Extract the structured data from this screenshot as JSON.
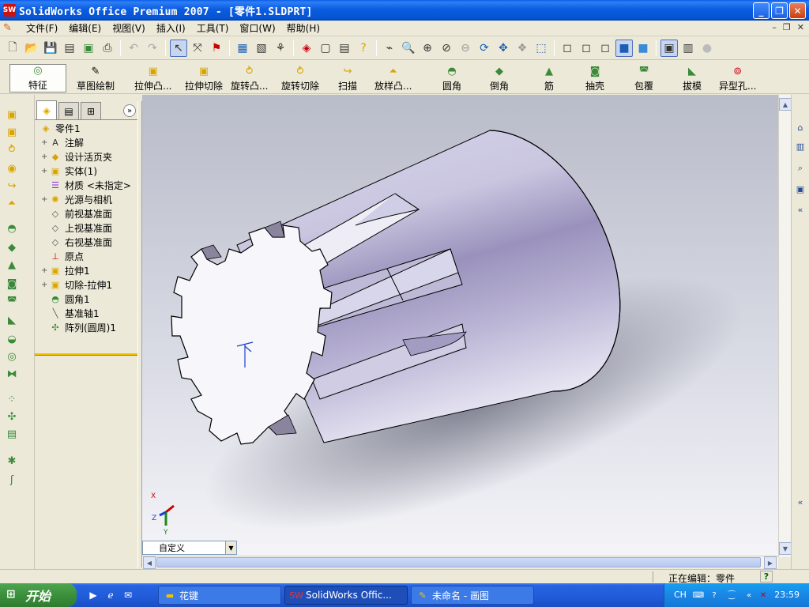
{
  "window": {
    "title": "SolidWorks Office Premium 2007 - [零件1.SLDPRT]",
    "app_icon": "SW"
  },
  "menu": {
    "items": [
      "文件(F)",
      "编辑(E)",
      "视图(V)",
      "插入(I)",
      "工具(T)",
      "窗口(W)",
      "帮助(H)"
    ]
  },
  "command_manager": {
    "tab_feature": "特征",
    "tab_sketch": "草图绘制",
    "commands": [
      "拉伸凸...",
      "拉伸切除",
      "旋转凸...",
      "旋转切除",
      "扫描",
      "放样凸...",
      "圆角",
      "倒角",
      "筋",
      "抽壳",
      "包覆",
      "拔模",
      "异型孔..."
    ]
  },
  "feature_tree": {
    "items": [
      {
        "label": "零件1",
        "icon": "part-icon",
        "expandable": false,
        "indent": 0
      },
      {
        "label": "注解",
        "icon": "annotation-icon",
        "expandable": true,
        "indent": 1
      },
      {
        "label": "设计活页夹",
        "icon": "design-binder-icon",
        "expandable": true,
        "indent": 1
      },
      {
        "label": "实体(1)",
        "icon": "solid-bodies-icon",
        "expandable": true,
        "indent": 1
      },
      {
        "label": "材质 <未指定>",
        "icon": "material-icon",
        "expandable": false,
        "indent": 1
      },
      {
        "label": "光源与相机",
        "icon": "lights-icon",
        "expandable": true,
        "indent": 1
      },
      {
        "label": "前视基准面",
        "icon": "plane-icon",
        "expandable": false,
        "indent": 1
      },
      {
        "label": "上视基准面",
        "icon": "plane-icon",
        "expandable": false,
        "indent": 1
      },
      {
        "label": "右视基准面",
        "icon": "plane-icon",
        "expandable": false,
        "indent": 1
      },
      {
        "label": "原点",
        "icon": "origin-icon",
        "expandable": false,
        "indent": 1
      },
      {
        "label": "拉伸1",
        "icon": "extrude-icon",
        "expandable": true,
        "indent": 1
      },
      {
        "label": "切除-拉伸1",
        "icon": "cut-extrude-icon",
        "expandable": true,
        "indent": 1
      },
      {
        "label": "圆角1",
        "icon": "fillet-icon",
        "expandable": false,
        "indent": 1
      },
      {
        "label": "基准轴1",
        "icon": "axis-icon",
        "expandable": false,
        "indent": 1
      },
      {
        "label": "阵列(圆周)1",
        "icon": "circular-pattern-icon",
        "expandable": false,
        "indent": 1
      }
    ]
  },
  "viewport": {
    "view_orientation": "自定义",
    "triad_labels": [
      "X",
      "Y",
      "Z"
    ],
    "colors": {
      "body": "#c8c4dc",
      "body_shade": "#8e86b0",
      "face": "#f4f4fa",
      "edge": "#000000"
    }
  },
  "status": {
    "text": "正在编辑：零件",
    "help": "?"
  },
  "taskbar": {
    "start": "开始",
    "buttons": [
      "花键",
      "SolidWorks Offic...",
      "未命名 - 画图"
    ],
    "active_index": 1,
    "lang": "CH",
    "clock": "23:59"
  }
}
